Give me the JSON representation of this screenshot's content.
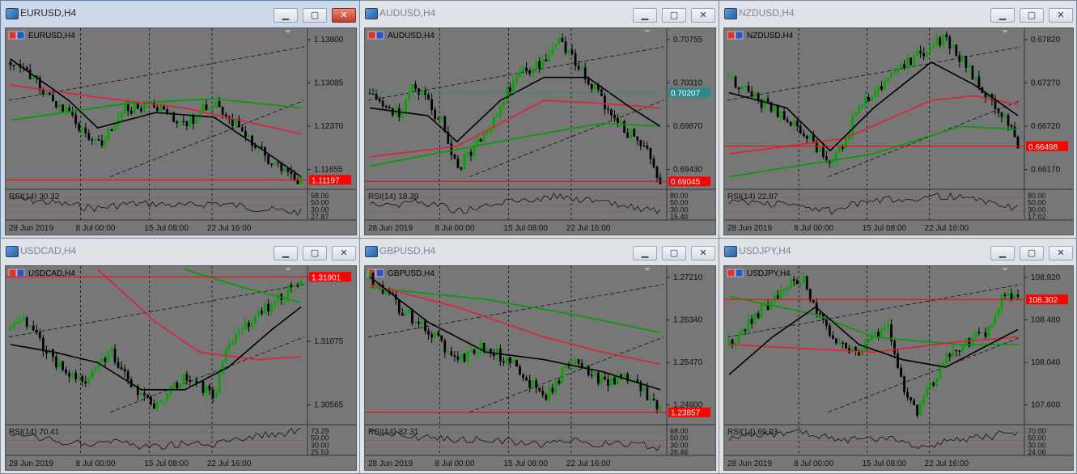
{
  "windows": [
    {
      "id": "eurusd",
      "title": "EURUSD,H4",
      "active": true,
      "chart_label": "EURUSD,H4",
      "price_levels": [
        "1.13800",
        "1.13085",
        "1.12370",
        "1.11655"
      ],
      "current_price": "1.11197",
      "rsi_label": "RSI(14) 30.32",
      "rsi_levels": [
        "58.06",
        "50.00",
        "30.00",
        "27.87"
      ],
      "dates": [
        "28 Jun 2019",
        "8 Jul 00:00",
        "15 Jul 08:00",
        "22 Jul 16:00"
      ]
    },
    {
      "id": "audusd",
      "title": "AUDUSD,H4",
      "active": false,
      "chart_label": "AUDUSD,H4",
      "price_levels": [
        "0.70755",
        "0.70310",
        "0.69870",
        "0.69430"
      ],
      "current_price": "0.69045",
      "highlight_price": "0.70207",
      "rsi_label": "RSI(14) 18.39",
      "rsi_levels": [
        "80.00",
        "50.00",
        "30.00",
        "15.40"
      ],
      "dates": [
        "28 Jun 2019",
        "8 Jul 00:00",
        "15 Jul 08:00",
        "22 Jul 16:00"
      ]
    },
    {
      "id": "nzdusd",
      "title": "NZDUSD,H4",
      "active": false,
      "chart_label": "NZDUSD,H4",
      "price_levels": [
        "0.67820",
        "0.67270",
        "0.66720",
        "0.66170"
      ],
      "current_price": "0.66498",
      "rsi_label": "RSI(14) 22.87",
      "rsi_levels": [
        "80.00",
        "50.00",
        "30.00",
        "17.02"
      ],
      "dates": [
        "28 Jun 2019",
        "8 Jul 00:00",
        "15 Jul 08:00",
        "22 Jul 16:00"
      ]
    },
    {
      "id": "usdcad",
      "title": "USDCAD,H4",
      "active": false,
      "chart_label": "USDCAD,H4",
      "price_levels": [
        "1.31590",
        "1.31075",
        "1.30565"
      ],
      "current_price": "1.31901",
      "rsi_label": "RSI(14) 70.41",
      "rsi_levels": [
        "73.29",
        "50.00",
        "30.00",
        "25.53"
      ],
      "dates": [
        "28 Jun 2019",
        "8 Jul 00:00",
        "15 Jul 08:00",
        "22 Jul 16:00"
      ]
    },
    {
      "id": "gbpusd",
      "title": "GBPUSD,H4",
      "active": false,
      "chart_label": "GBPUSD,H4",
      "price_levels": [
        "1.27210",
        "1.26340",
        "1.25470",
        "1.24600"
      ],
      "current_price": "1.23857",
      "rsi_label": "RSI(14) 32.31",
      "rsi_levels": [
        "68.00",
        "50.00",
        "30.00",
        "26.46"
      ],
      "dates": [
        "28 Jun 2019",
        "8 Jul 00:00",
        "15 Jul 08:00",
        "22 Jul 16:00"
      ]
    },
    {
      "id": "usdjpy",
      "title": "USDJPY,H4",
      "active": false,
      "chart_label": "USDJPY,H4",
      "price_levels": [
        "108.920",
        "108.480",
        "108.040",
        "107.600"
      ],
      "current_price": "108.302",
      "rsi_label": "RSI(14) 69.03",
      "rsi_levels": [
        "70.00",
        "50.00",
        "30.00",
        "24.06"
      ],
      "dates": [
        "28 Jun 2019",
        "8 Jul 00:00",
        "15 Jul 08:00",
        "22 Jul 16:00"
      ]
    }
  ],
  "buttons": {
    "minimize": "▁",
    "maximize": "▢",
    "close": "✕"
  },
  "colors": {
    "chart_bg": "#777777",
    "bull": "#00a800",
    "bear": "#000000",
    "ma_fast": "#000000",
    "ma_mid": "#e0203c",
    "ma_slow": "#00a000",
    "price_tag": "#ff0000",
    "highlight_tag": "#2e8a8a"
  }
}
